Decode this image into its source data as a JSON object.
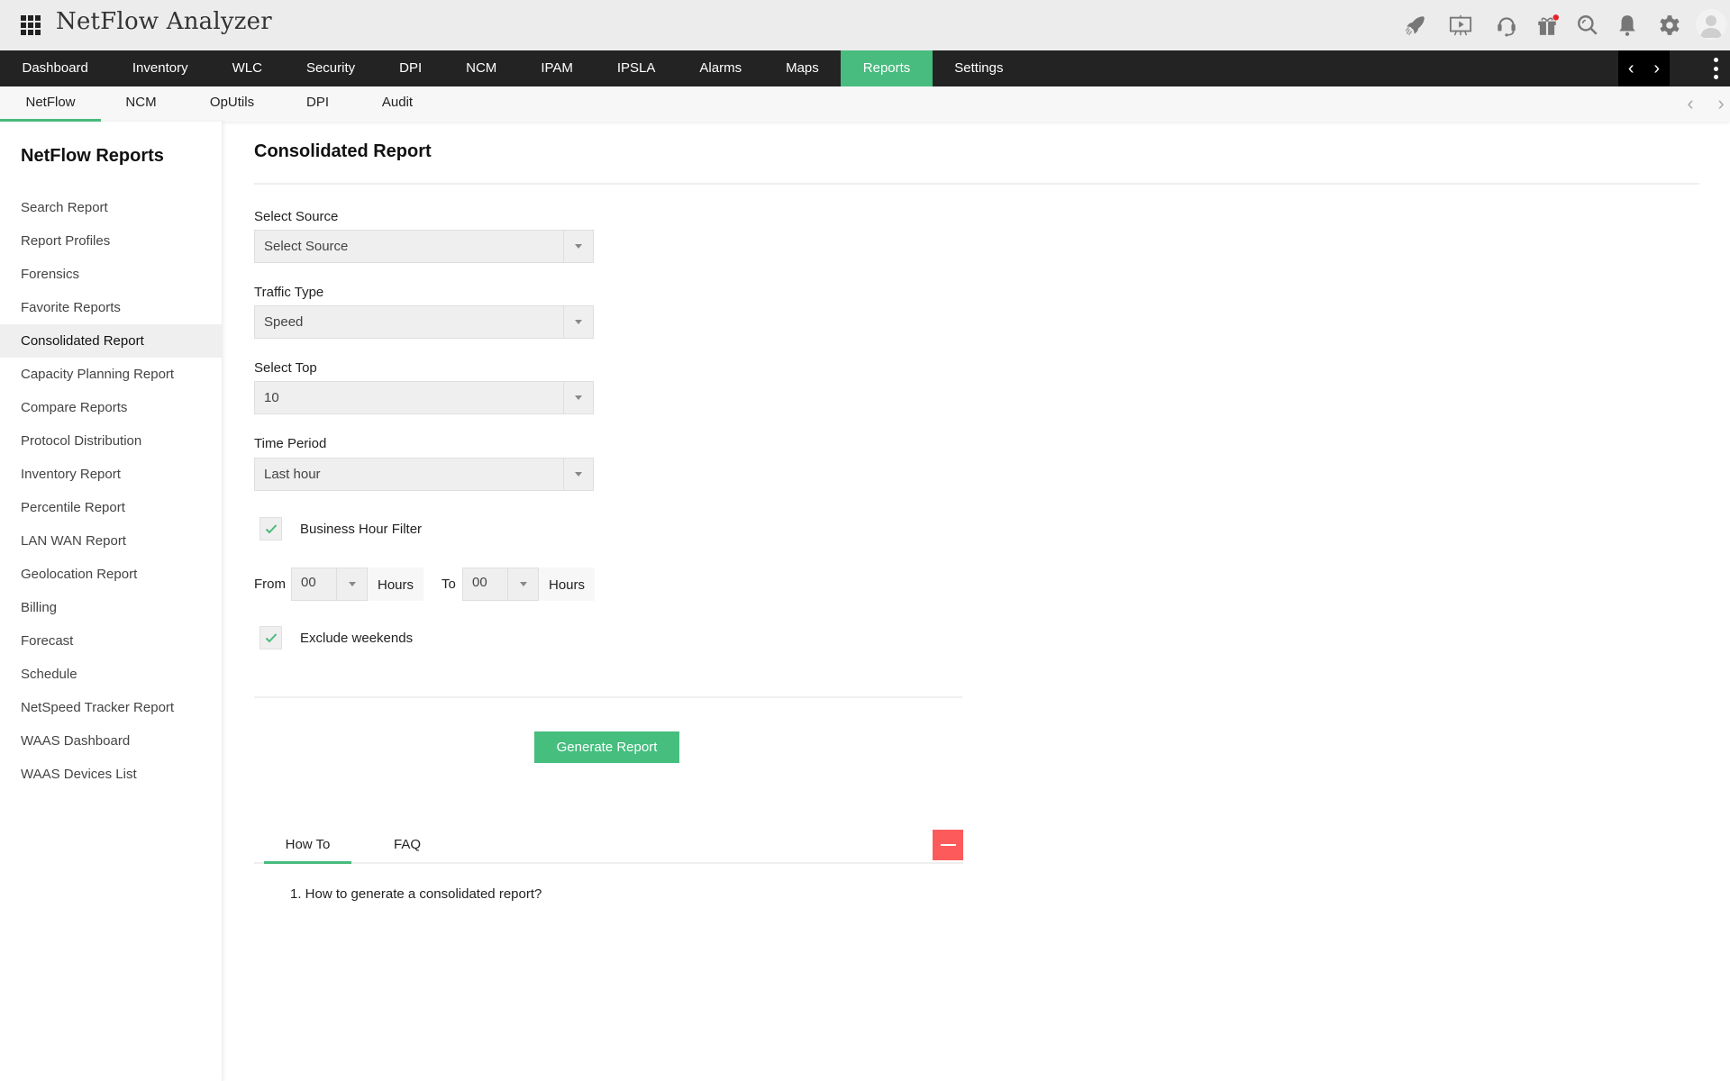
{
  "app": {
    "title": "NetFlow Analyzer"
  },
  "header_icons": [
    {
      "name": "rocket-icon",
      "label": "Quick start"
    },
    {
      "name": "presentation-icon",
      "label": "Demo"
    },
    {
      "name": "headset-icon",
      "label": "Support"
    },
    {
      "name": "gift-icon",
      "label": "What's new",
      "badge": true
    },
    {
      "name": "search-icon",
      "label": "Search"
    },
    {
      "name": "bell-icon",
      "label": "Alarms"
    },
    {
      "name": "gear-icon",
      "label": "Settings"
    },
    {
      "name": "user-avatar-icon",
      "label": "User"
    }
  ],
  "colors": {
    "accent": "#48bb7e",
    "nav_bg": "#232323",
    "danger": "#fd5b5b",
    "badge": "#e8232a"
  },
  "main_nav": {
    "items": [
      "Dashboard",
      "Inventory",
      "WLC",
      "Security",
      "DPI",
      "NCM",
      "IPAM",
      "IPSLA",
      "Alarms",
      "Maps",
      "Reports",
      "Settings"
    ],
    "active": "Reports"
  },
  "sub_nav": {
    "items": [
      "NetFlow",
      "NCM",
      "OpUtils",
      "DPI",
      "Audit"
    ],
    "active": "NetFlow"
  },
  "sidebar": {
    "title": "NetFlow Reports",
    "items": [
      "Search Report",
      "Report Profiles",
      "Forensics",
      "Favorite Reports",
      "Consolidated Report",
      "Capacity Planning Report",
      "Compare Reports",
      "Protocol Distribution",
      "Inventory Report",
      "Percentile Report",
      "LAN WAN Report",
      "Geolocation Report",
      "Billing",
      "Forecast",
      "Schedule",
      "NetSpeed Tracker Report",
      "WAAS Dashboard",
      "WAAS Devices List"
    ],
    "active": "Consolidated Report"
  },
  "form": {
    "title": "Consolidated Report",
    "select_source": {
      "label": "Select Source",
      "value": "Select Source"
    },
    "traffic_type": {
      "label": "Traffic Type",
      "value": "Speed"
    },
    "select_top": {
      "label": "Select Top",
      "value": "10"
    },
    "time_period": {
      "label": "Time Period",
      "value": "Last hour"
    },
    "business_hour_filter": {
      "label": "Business Hour Filter",
      "checked": true
    },
    "from": {
      "label": "From",
      "value": "00",
      "unit": "Hours"
    },
    "to": {
      "label": "To",
      "value": "00",
      "unit": "Hours"
    },
    "exclude_weekends": {
      "label": "Exclude weekends",
      "checked": true
    },
    "generate_button": "Generate Report"
  },
  "help": {
    "tabs": [
      "How To",
      "FAQ"
    ],
    "active": "How To",
    "items": [
      "1. How to generate a consolidated report?"
    ]
  }
}
